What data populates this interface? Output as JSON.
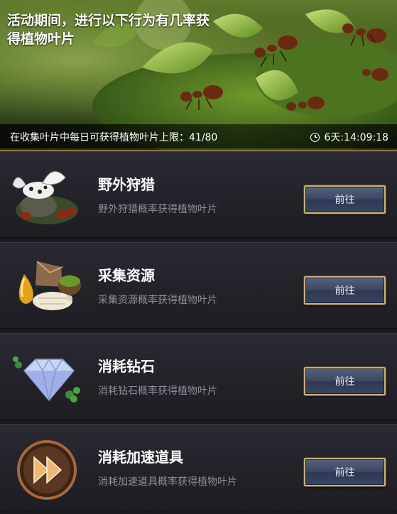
{
  "banner": {
    "title": "活动期间，进行以下行为有几率获得植物叶片",
    "limit_text": "在收集叶片中每日可获得植物叶片上限：41/80",
    "timer": "6天:14:09:18"
  },
  "tasks": [
    {
      "title": "野外狩猎",
      "description": "野外狩猎概率获得植物叶片",
      "button_label": "前往",
      "icon": "beetle-hunt-icon"
    },
    {
      "title": "采集资源",
      "description": "采集资源概率获得植物叶片",
      "button_label": "前往",
      "icon": "resource-gather-icon"
    },
    {
      "title": "消耗钻石",
      "description": "消耗钻石概率获得植物叶片",
      "button_label": "前往",
      "icon": "diamond-icon"
    },
    {
      "title": "消耗加速道具",
      "description": "消耗加速道具概率获得植物叶片",
      "button_label": "前往",
      "icon": "speedup-icon"
    }
  ]
}
